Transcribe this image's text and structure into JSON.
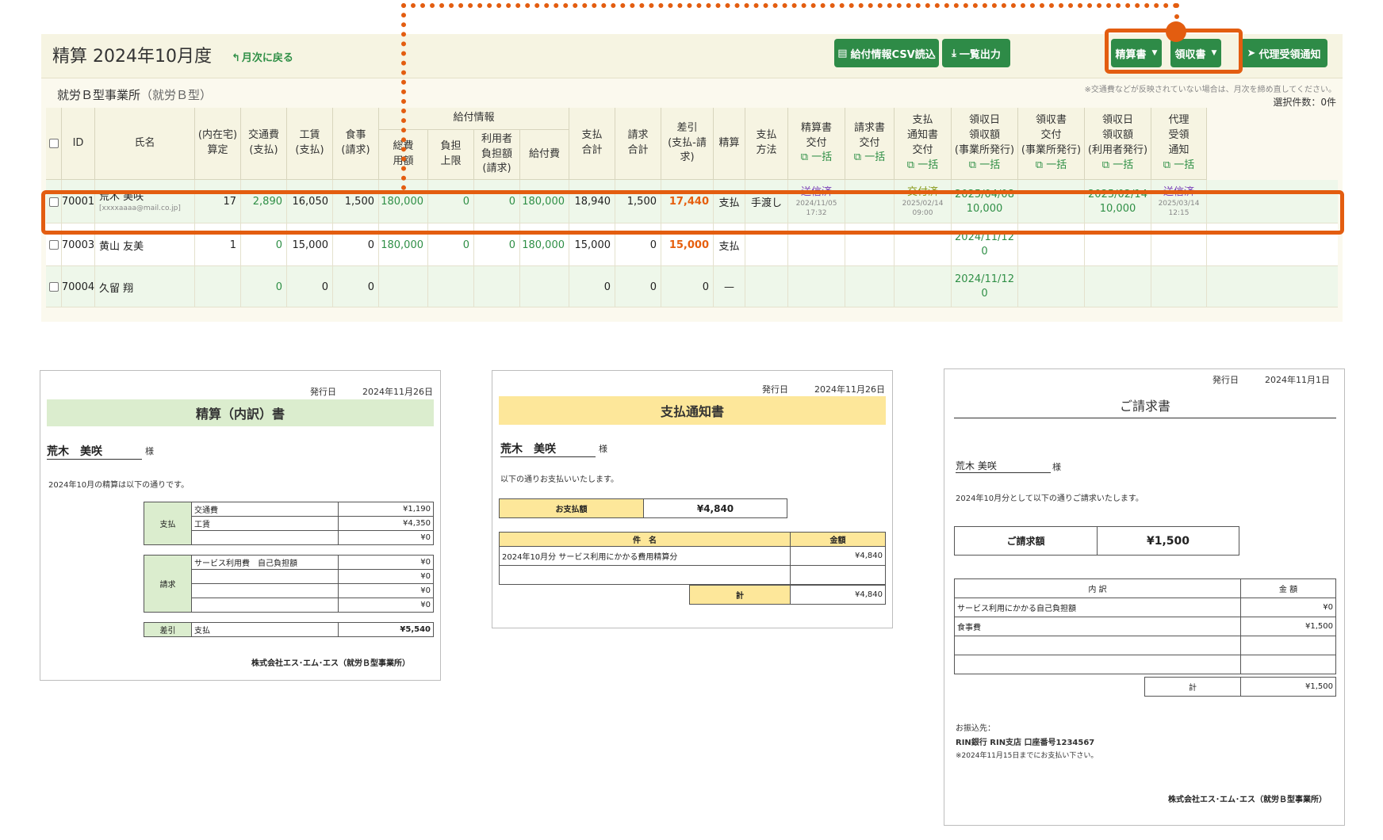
{
  "header": {
    "title": "精算 2024年10月度",
    "back_link": "月次に戻る",
    "buttons": {
      "csv": "給付情報CSV読込",
      "list_export": "一覧出力",
      "settlement": "精算書",
      "receipt": "領収書",
      "proxy": "代理受領通知"
    }
  },
  "office": {
    "name": "就労Ｂ型事業所",
    "type": "（就労Ｂ型）",
    "note": "※交通費などが反映されていない場合は、月次を締め直してください。",
    "selected": "選択件数：0件"
  },
  "table": {
    "group_benefit": "給付情報",
    "bulk": "一括",
    "columns": {
      "id": "ID",
      "name": "氏名",
      "home": [
        "(内在宅)",
        "算定"
      ],
      "transport": [
        "交通費",
        "(支払)"
      ],
      "wage": [
        "工賃",
        "(支払)"
      ],
      "meal": [
        "食事",
        "(請求)"
      ],
      "total_cost": [
        "総費",
        "用額"
      ],
      "burden_limit": [
        "負担",
        "上限"
      ],
      "user_burden": [
        "利用者",
        "負担額",
        "(請求)"
      ],
      "benefit": "給付費",
      "pay_total": [
        "支払",
        "合計"
      ],
      "bill_total": [
        "請求",
        "合計"
      ],
      "diff": [
        "差引",
        "(支払-請",
        "求)"
      ],
      "settle": "精算",
      "pay_method": [
        "支払",
        "方法"
      ],
      "settle_doc": [
        "精算書",
        "交付"
      ],
      "bill_doc": [
        "請求書",
        "交付"
      ],
      "pay_notice": [
        "支払",
        "通知書",
        "交付"
      ],
      "receipt_date": [
        "領収日",
        "領収額",
        "(事業所発行)"
      ],
      "receipt_issue": [
        "領収書",
        "交付",
        "(事業所発行)"
      ],
      "receipt_user": [
        "領収日",
        "領収額",
        "(利用者発行)"
      ],
      "proxy": [
        "代理",
        "受領",
        "通知"
      ]
    },
    "rows": [
      {
        "id": "70001",
        "name": "荒木 美咲",
        "email": "[xxxxaaaa@mail.co.jp]",
        "home": "17",
        "transport": "2,890",
        "wage": "16,050",
        "meal": "1,500",
        "total_cost": "180,000",
        "burden_limit": "0",
        "user_burden": "0",
        "benefit": "180,000",
        "pay_total": "18,940",
        "bill_total": "1,500",
        "diff": "17,440",
        "settle": "支払",
        "pay_method": "手渡し",
        "settle_doc": {
          "status": "送信済",
          "date": "2024/11/05",
          "time": "17:32"
        },
        "pay_notice": {
          "status": "交付済",
          "date": "2025/02/14",
          "time": "09:00"
        },
        "receipt_date": {
          "date": "2025/04/08",
          "amount": "10,000"
        },
        "receipt_user": {
          "date": "2025/02/14",
          "amount": "10,000"
        },
        "proxy": {
          "status": "送信済",
          "date": "2025/03/14",
          "time": "12:15"
        }
      },
      {
        "id": "70003",
        "name": "黄山 友美",
        "home": "1",
        "transport": "0",
        "wage": "15,000",
        "meal": "0",
        "total_cost": "180,000",
        "burden_limit": "0",
        "user_burden": "0",
        "benefit": "180,000",
        "pay_total": "15,000",
        "bill_total": "0",
        "diff": "15,000",
        "settle": "支払",
        "receipt_date": {
          "date": "2024/11/12",
          "amount": "0"
        }
      },
      {
        "id": "70004",
        "name": "久留 翔",
        "transport": "0",
        "wage": "0",
        "meal": "0",
        "pay_total": "0",
        "bill_total": "0",
        "diff": "0",
        "settle": "—",
        "receipt_date": {
          "date": "2024/11/12",
          "amount": "0"
        }
      }
    ]
  },
  "doc_settlement": {
    "issue_label": "発行日",
    "issue_date": "2024年11月26日",
    "title": "精算（内訳）書",
    "recipient": "荒木　美咲",
    "sama": "様",
    "intro": "2024年10月の精算は以下の通りです。",
    "pay_label": "支払",
    "pay_rows": [
      [
        "交通費",
        "¥1,190"
      ],
      [
        "工賃",
        "¥4,350"
      ],
      [
        "",
        "¥0"
      ]
    ],
    "bill_label": "請求",
    "bill_rows": [
      [
        "サービス利用費　自己負担額",
        "¥0"
      ],
      [
        "",
        "¥0"
      ],
      [
        "",
        "¥0"
      ],
      [
        "",
        "¥0"
      ]
    ],
    "diff_label": "差引",
    "diff_kind": "支払",
    "diff_amount": "¥5,540",
    "company": "株式会社エス･エム･エス（就労Ｂ型事業所）"
  },
  "doc_notice": {
    "issue_label": "発行日",
    "issue_date": "2024年11月26日",
    "title": "支払通知書",
    "recipient": "荒木　美咲",
    "sama": "様",
    "intro": "以下の通りお支払いいたします。",
    "amount_label": "お支払額",
    "amount": "¥4,840",
    "col_item": "件　名",
    "col_amount": "金額",
    "rows": [
      [
        "2024年10月分 サービス利用にかかる費用精算分",
        "¥4,840"
      ],
      [
        "",
        ""
      ]
    ],
    "total_label": "計",
    "total": "¥4,840"
  },
  "doc_invoice": {
    "issue_label": "発行日",
    "issue_date": "2024年11月1日",
    "title": "ご請求書",
    "recipient": "荒木  美咲",
    "sama": "様",
    "intro": "2024年10月分として以下の通りご請求いたします。",
    "amount_label": "ご請求額",
    "amount": "¥1,500",
    "col_item": "内 訳",
    "col_amount": "金 額",
    "rows": [
      [
        "サービス利用にかかる自己負担額",
        "¥0"
      ],
      [
        "食事費",
        "¥1,500"
      ],
      [
        "",
        ""
      ],
      [
        "",
        ""
      ]
    ],
    "total_label": "計",
    "total": "¥1,500",
    "bank_label": "お振込先：",
    "bank": "RIN銀行  RIN支店  口座番号1234567",
    "deadline": "※2024年11月15日までにお支払い下さい。",
    "company": "株式会社エス･エム･エス（就労Ｂ型事業所）"
  },
  "colors": {
    "accent": "#e35d10",
    "green": "#2e8b47",
    "panel": "#fbf9ee"
  }
}
